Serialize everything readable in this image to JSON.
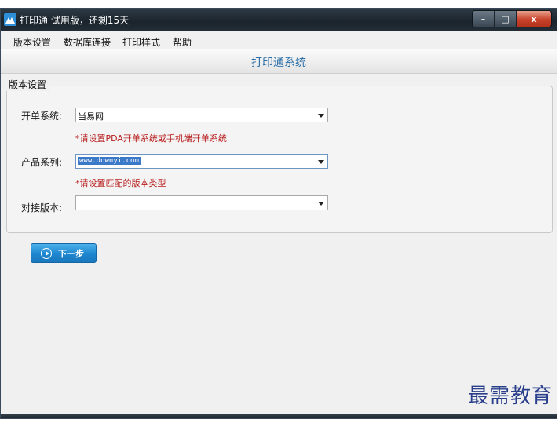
{
  "window": {
    "title": "打印通  试用版，还剩15天",
    "minimize_label": "–",
    "maximize_label": "□",
    "close_label": "x"
  },
  "menu": {
    "items": [
      "版本设置",
      "数据库连接",
      "打印样式",
      "帮助"
    ]
  },
  "header": {
    "title": "打印通系统"
  },
  "group": {
    "title": "版本设置"
  },
  "form": {
    "fields": [
      {
        "label": "开单系统:",
        "value": "当易网",
        "hint": "*请设置PDA开单系统或手机端开单系统"
      },
      {
        "label": "产品系列:",
        "value": "www.downyi.com",
        "hint": "*请设置匹配的版本类型"
      },
      {
        "label": "对接版本:",
        "value": ""
      }
    ]
  },
  "next_button": {
    "label": "下一步"
  },
  "watermark": {
    "text": "最需教育"
  },
  "colors": {
    "titlebar": "#1b242c",
    "accent": "#2b6fa8",
    "button": "#1d86cf",
    "hint": "#b81d1d",
    "close": "#c7432b"
  }
}
